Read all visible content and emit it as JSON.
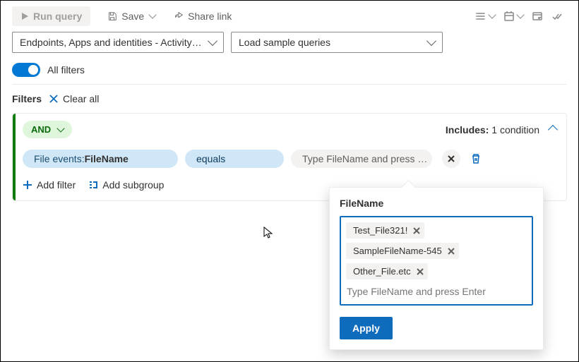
{
  "toolbar": {
    "run_label": "Run query",
    "save_label": "Save",
    "share_label": "Share link"
  },
  "dropdowns": {
    "source": "Endpoints, Apps and identities - Activity…",
    "samples": "Load sample queries"
  },
  "toggle": {
    "label": "All filters"
  },
  "filters_header": {
    "label": "Filters",
    "clear": "Clear all"
  },
  "card": {
    "logic": "AND",
    "includes_label": "Includes:",
    "includes_count": "1 condition",
    "field_prefix": "File events: ",
    "field_name": "FileName",
    "operator": "equals",
    "value_placeholder": "Type FileName and press …",
    "add_filter": "Add filter",
    "add_subgroup": "Add subgroup"
  },
  "popup": {
    "title": "FileName",
    "tags": [
      "Test_File321!",
      "SampleFileName-545",
      "Other_File.etc"
    ],
    "input_placeholder": "Type FileName and press Enter",
    "apply": "Apply"
  }
}
